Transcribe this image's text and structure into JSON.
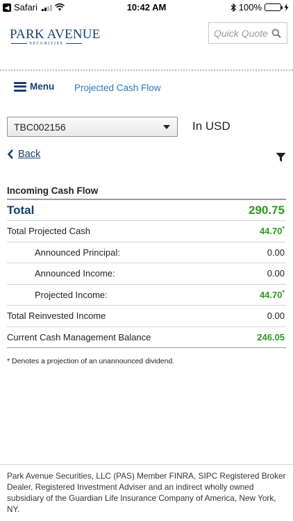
{
  "status_bar": {
    "back_app": "Safari",
    "time": "10:42 AM",
    "battery_pct": "100%"
  },
  "header": {
    "logo_main": "PARK AVENUE",
    "logo_sub": "SECURITIES",
    "quick_quote_placeholder": "Quick Quote",
    "brand_color": "#14406f"
  },
  "nav": {
    "menu_label": "Menu",
    "current_page": "Projected Cash Flow"
  },
  "account": {
    "selected": "TBC002156",
    "currency_label": "In USD"
  },
  "actions": {
    "back_label": "Back"
  },
  "cash_flow": {
    "section_title": "Incoming Cash Flow",
    "rows": [
      {
        "label": "Total",
        "value": "290.75",
        "marker": ""
      },
      {
        "label": "Total Projected Cash",
        "value": "44.70",
        "marker": "*"
      },
      {
        "label": "Announced Principal:",
        "value": "0.00",
        "marker": ""
      },
      {
        "label": "Announced Income:",
        "value": "0.00",
        "marker": ""
      },
      {
        "label": "Projected Income:",
        "value": "44.70",
        "marker": "*"
      },
      {
        "label": "Total Reinvested Income",
        "value": "0.00",
        "marker": ""
      },
      {
        "label": "Current Cash Management Balance",
        "value": "246.05",
        "marker": ""
      }
    ],
    "footnote": "* Denotes a projection of an unannounced dividend.",
    "positive_color": "#2a9a1a"
  },
  "footer": {
    "disclaimer": "Park Avenue Securities, LLC (PAS) Member FINRA, SIPC Registered Broker Dealer, Registered Investment Adviser and an indirect wholly owned subsidiary of the Guardian Life Insurance Company of America, New York, NY."
  }
}
